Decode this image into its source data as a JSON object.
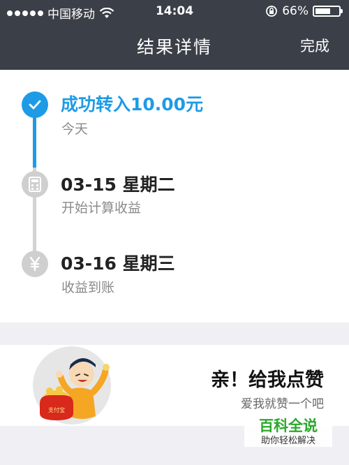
{
  "status_bar": {
    "carrier": "中国移动",
    "time": "14:04",
    "battery": "66%",
    "battery_level": 0.66,
    "icons": [
      "signal-dots-icon",
      "wifi-icon",
      "rotation-lock-icon",
      "battery-icon"
    ]
  },
  "header": {
    "title": "结果详情",
    "done_label": "完成"
  },
  "colors": {
    "header_bg": "#3b3f48",
    "accent_blue": "#1e9be6",
    "inactive_gray": "#cfcfcf",
    "watermark_green": "#2aa82a"
  },
  "timeline": {
    "steps": [
      {
        "title": "成功转入10.00元",
        "subtitle": "今天",
        "icon": "check-icon",
        "state": "done"
      },
      {
        "title": "03-15 星期二",
        "subtitle": "开始计算收益",
        "icon": "calculator-icon",
        "state": "pending"
      },
      {
        "title": "03-16 星期三",
        "subtitle": "收益到账",
        "icon": "yuan-icon",
        "state": "pending"
      }
    ]
  },
  "promo": {
    "headline": "亲！给我点赞",
    "subline": "爱我就赞一个吧",
    "bag_text": "支付宝"
  },
  "watermark": {
    "main": "百科全说",
    "sub": "助你轻松解决"
  }
}
